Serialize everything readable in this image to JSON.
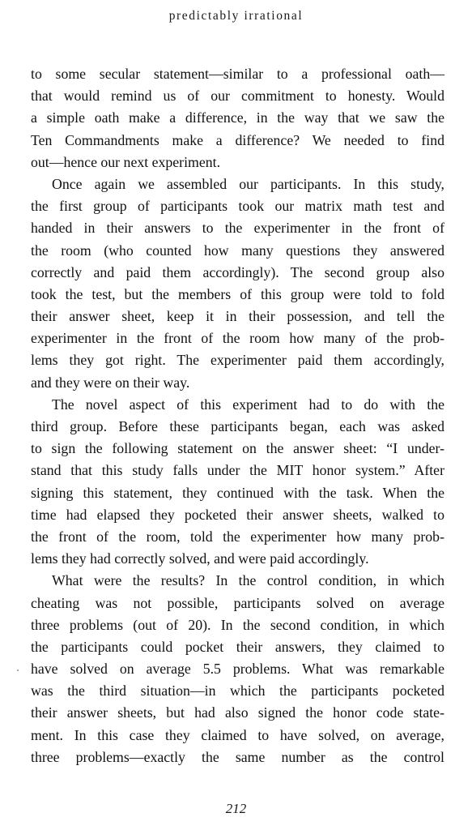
{
  "running_head": "predictably irrational",
  "page_number": "212",
  "lines": [
    "to some secular statement—similar to a professional oath—",
    "that would remind us of our commitment to honesty. Would",
    "a simple oath make a difference, in the way that we saw the",
    "Ten Commandments make a difference? We needed to find",
    "out—hence our next experiment.",
    "Once again we assembled our participants. In this study,",
    "the first group of participants took our matrix math test and",
    "handed in their answers to the experimenter in the front of",
    "the room (who counted how many questions they answered",
    "correctly and paid them accordingly). The second group also",
    "took the test, but the members of this group were told to fold",
    "their answer sheet, keep it in their possession, and tell the",
    "experimenter in the front of the room how many of the prob-",
    "lems they got right. The experimenter paid them accordingly,",
    "and they were on their way.",
    "The novel aspect of this experiment had to do with the",
    "third group. Before these participants began, each was asked",
    "to sign the following statement on the answer sheet: “I under-",
    "stand that this study falls under the MIT honor system.” After",
    "signing this statement, they continued with the task. When the",
    "time had elapsed they pocketed their answer sheets, walked to",
    "the front of the room, told the experimenter how many prob-",
    "lems they had correctly solved, and were paid accordingly.",
    "What were the results? In the control condition, in which",
    "cheating was not possible, participants solved on average",
    "three problems (out of 20). In the second condition, in which",
    "the participants could pocket their answers, they claimed to",
    "have solved on average 5.5 problems. What was remarkable",
    "was the third situation—in which the participants pocketed",
    "their answer sheets, but had also signed the honor code state-",
    "ment. In this case they claimed to have solved, on average,",
    "three problems—exactly the same number as the control"
  ]
}
